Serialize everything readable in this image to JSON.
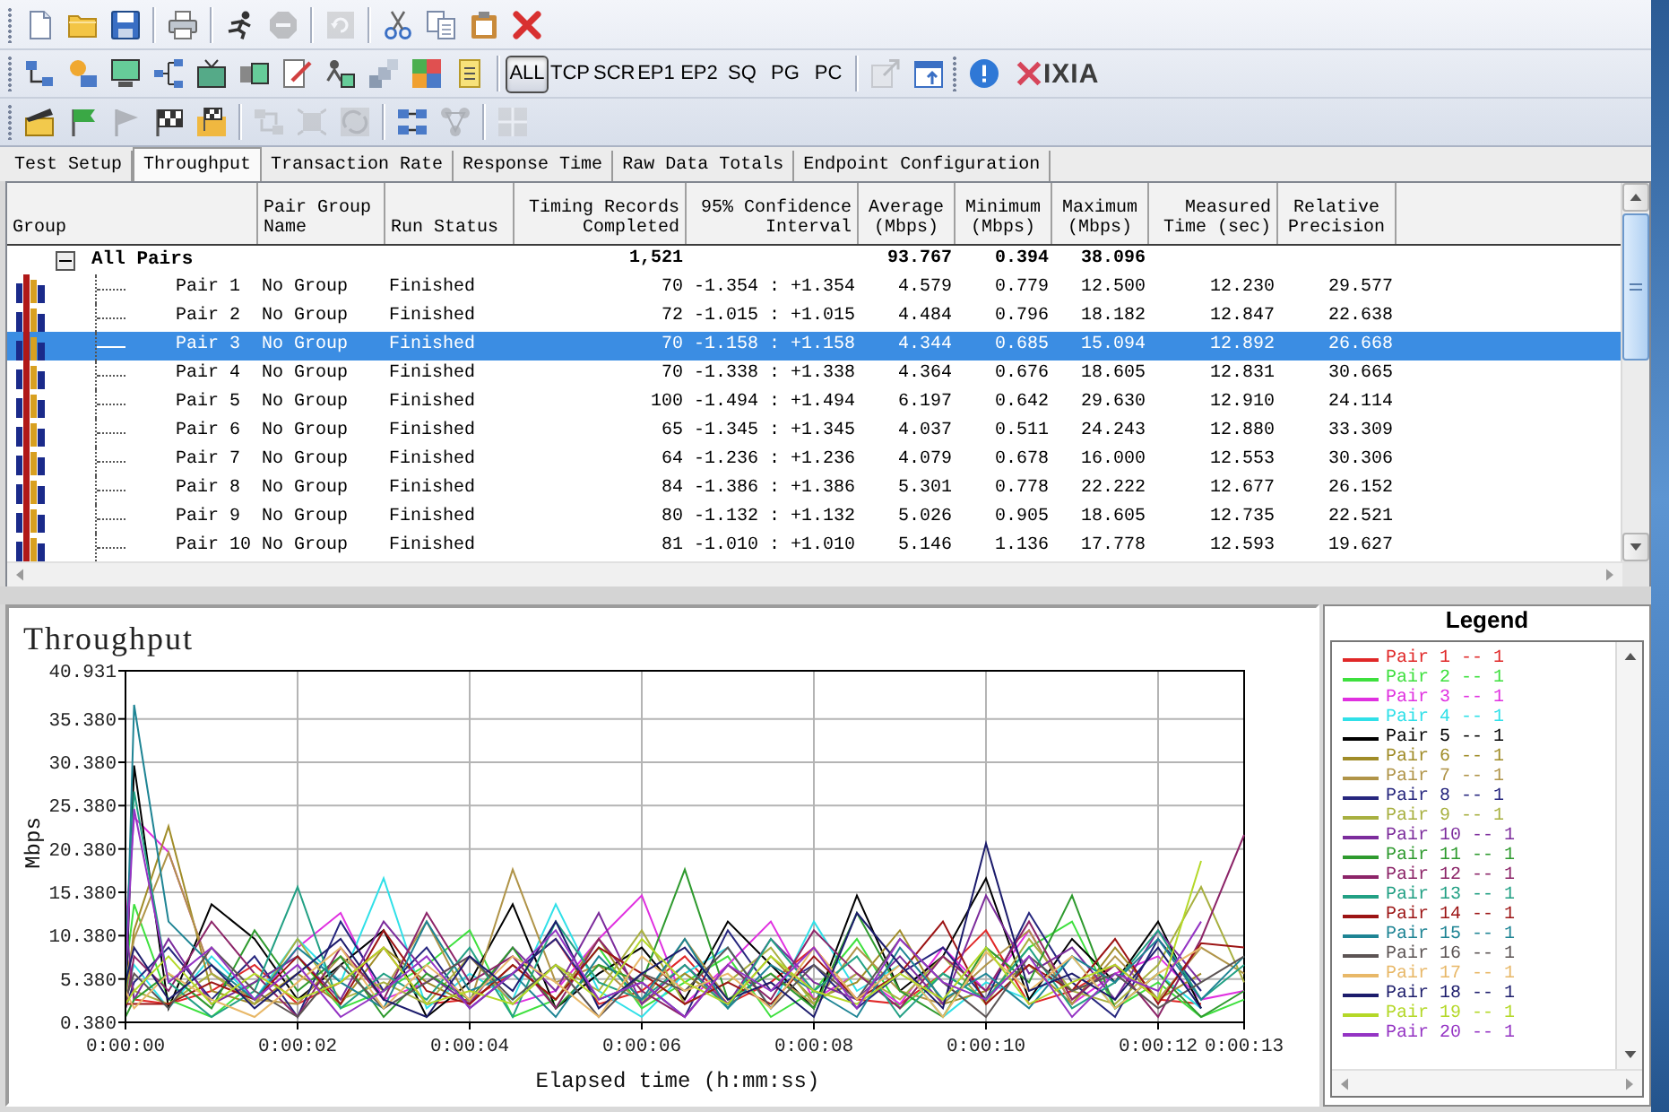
{
  "toolbar_rows": [
    {
      "items": [
        {
          "kind": "grip"
        },
        {
          "kind": "button",
          "disabled": false
        },
        {
          "kind": "button",
          "disabled": false
        },
        {
          "kind": "button",
          "disabled": false
        },
        {
          "kind": "separator"
        },
        {
          "kind": "button",
          "disabled": false
        },
        {
          "kind": "separator"
        },
        {
          "kind": "button",
          "disabled": false
        },
        {
          "kind": "button",
          "disabled": true
        },
        {
          "kind": "separator"
        },
        {
          "kind": "button",
          "disabled": true
        },
        {
          "kind": "separator"
        },
        {
          "kind": "button",
          "disabled": false
        },
        {
          "kind": "button",
          "disabled": false
        },
        {
          "kind": "button",
          "disabled": false
        },
        {
          "kind": "button",
          "disabled": false
        }
      ]
    },
    {
      "items": [
        {
          "kind": "grip"
        },
        {
          "kind": "button",
          "disabled": false
        },
        {
          "kind": "button",
          "disabled": false
        },
        {
          "kind": "button",
          "disabled": false
        },
        {
          "kind": "button",
          "disabled": false
        },
        {
          "kind": "button",
          "disabled": false
        },
        {
          "kind": "button",
          "disabled": false
        },
        {
          "kind": "button",
          "disabled": false
        },
        {
          "kind": "button",
          "disabled": false
        },
        {
          "kind": "button",
          "disabled": false
        },
        {
          "kind": "button",
          "disabled": false
        },
        {
          "kind": "button",
          "disabled": false
        },
        {
          "kind": "separator"
        },
        {
          "kind": "toggle",
          "label": "ALL",
          "selected": true
        },
        {
          "kind": "toggle",
          "label": "TCP",
          "selected": false
        },
        {
          "kind": "toggle",
          "label": "SCR",
          "selected": false
        },
        {
          "kind": "toggle",
          "label": "EP1",
          "selected": false
        },
        {
          "kind": "toggle",
          "label": "EP2",
          "selected": false
        },
        {
          "kind": "toggle",
          "label": "SQ",
          "selected": false
        },
        {
          "kind": "toggle",
          "label": "PG",
          "selected": false
        },
        {
          "kind": "toggle",
          "label": "PC",
          "selected": false
        },
        {
          "kind": "separator"
        },
        {
          "kind": "button",
          "disabled": true
        },
        {
          "kind": "button",
          "disabled": false
        },
        {
          "kind": "grip"
        },
        {
          "kind": "button",
          "disabled": false
        },
        {
          "kind": "logo",
          "text": "IXIA"
        }
      ]
    },
    {
      "items": [
        {
          "kind": "grip"
        },
        {
          "kind": "button",
          "disabled": false
        },
        {
          "kind": "button",
          "disabled": false
        },
        {
          "kind": "button",
          "disabled": true
        },
        {
          "kind": "button",
          "disabled": false
        },
        {
          "kind": "button",
          "disabled": false
        },
        {
          "kind": "separator"
        },
        {
          "kind": "button",
          "disabled": true
        },
        {
          "kind": "button",
          "disabled": true
        },
        {
          "kind": "button",
          "disabled": true
        },
        {
          "kind": "separator"
        },
        {
          "kind": "button",
          "disabled": false
        },
        {
          "kind": "button",
          "disabled": true
        },
        {
          "kind": "separator"
        },
        {
          "kind": "button",
          "disabled": true
        }
      ]
    }
  ],
  "tabs": [
    {
      "label": "Test Setup",
      "selected": false
    },
    {
      "label": "Throughput",
      "selected": true
    },
    {
      "label": "Transaction Rate",
      "selected": false
    },
    {
      "label": "Response Time",
      "selected": false
    },
    {
      "label": "Raw Data Totals",
      "selected": false
    },
    {
      "label": "Endpoint Configuration",
      "selected": false
    }
  ],
  "table": {
    "columns": [
      "Group",
      "Pair Group Name",
      "Run Status",
      "Timing Records Completed",
      "95% Confidence Interval",
      "Average (Mbps)",
      "Minimum (Mbps)",
      "Maximum (Mbps)",
      "Measured Time (sec)",
      "Relative Precision"
    ],
    "summary": {
      "label": "All Pairs",
      "expanded": true,
      "timing_records_completed": "1,521",
      "average": "93.767",
      "minimum": "0.394",
      "maximum": "38.096"
    },
    "rows": [
      {
        "cells": [
          "Pair 1",
          "No Group",
          "Finished",
          "70",
          "-1.354 : +1.354",
          "4.579",
          "0.779",
          "12.500",
          "12.230",
          "29.577"
        ],
        "selected": false
      },
      {
        "cells": [
          "Pair 2",
          "No Group",
          "Finished",
          "72",
          "-1.015 : +1.015",
          "4.484",
          "0.796",
          "18.182",
          "12.847",
          "22.638"
        ],
        "selected": false
      },
      {
        "cells": [
          "Pair 3",
          "No Group",
          "Finished",
          "70",
          "-1.158 : +1.158",
          "4.344",
          "0.685",
          "15.094",
          "12.892",
          "26.668"
        ],
        "selected": true
      },
      {
        "cells": [
          "Pair 4",
          "No Group",
          "Finished",
          "70",
          "-1.338 : +1.338",
          "4.364",
          "0.676",
          "18.605",
          "12.831",
          "30.665"
        ],
        "selected": false
      },
      {
        "cells": [
          "Pair 5",
          "No Group",
          "Finished",
          "100",
          "-1.494 : +1.494",
          "6.197",
          "0.642",
          "29.630",
          "12.910",
          "24.114"
        ],
        "selected": false
      },
      {
        "cells": [
          "Pair 6",
          "No Group",
          "Finished",
          "65",
          "-1.345 : +1.345",
          "4.037",
          "0.511",
          "24.243",
          "12.880",
          "33.309"
        ],
        "selected": false
      },
      {
        "cells": [
          "Pair 7",
          "No Group",
          "Finished",
          "64",
          "-1.236 : +1.236",
          "4.079",
          "0.678",
          "16.000",
          "12.553",
          "30.306"
        ],
        "selected": false
      },
      {
        "cells": [
          "Pair 8",
          "No Group",
          "Finished",
          "84",
          "-1.386 : +1.386",
          "5.301",
          "0.778",
          "22.222",
          "12.677",
          "26.152"
        ],
        "selected": false
      },
      {
        "cells": [
          "Pair 9",
          "No Group",
          "Finished",
          "80",
          "-1.132 : +1.132",
          "5.026",
          "0.905",
          "18.605",
          "12.735",
          "22.521"
        ],
        "selected": false
      },
      {
        "cells": [
          "Pair 10",
          "No Group",
          "Finished",
          "81",
          "-1.010 : +1.010",
          "5.146",
          "1.136",
          "17.778",
          "12.593",
          "19.627"
        ],
        "selected": false
      }
    ]
  },
  "chart_panel": {
    "chart_data": {
      "type": "line",
      "title": "Throughput",
      "xlabel": "Elapsed time (h:mm:ss)",
      "ylabel": "Mbps",
      "grid": true,
      "x": [
        0,
        0.1,
        0.5,
        1,
        1.5,
        2,
        2.5,
        3,
        3.5,
        4,
        4.5,
        5,
        5.5,
        6,
        6.5,
        7,
        7.5,
        8,
        8.5,
        9,
        9.5,
        10,
        10.5,
        11,
        11.5,
        12,
        12.5,
        13
      ],
      "xlim": [
        0,
        13
      ],
      "ylim": [
        0.38,
        40.931
      ],
      "xticks": [
        {
          "value": 0,
          "label": "0:00:00"
        },
        {
          "value": 2,
          "label": "0:00:02"
        },
        {
          "value": 4,
          "label": "0:00:04"
        },
        {
          "value": 6,
          "label": "0:00:06"
        },
        {
          "value": 8,
          "label": "0:00:08"
        },
        {
          "value": 10,
          "label": "0:00:10"
        },
        {
          "value": 12,
          "label": "0:00:12"
        },
        {
          "value": 13,
          "label": "0:00:13"
        }
      ],
      "yticks": [
        {
          "value": 0.38,
          "label": "0.380"
        },
        {
          "value": 5.38,
          "label": "5.380"
        },
        {
          "value": 10.38,
          "label": "10.380"
        },
        {
          "value": 15.38,
          "label": "15.380"
        },
        {
          "value": 20.38,
          "label": "20.380"
        },
        {
          "value": 25.38,
          "label": "25.380"
        },
        {
          "value": 30.38,
          "label": "30.380"
        },
        {
          "value": 35.38,
          "label": "35.380"
        },
        {
          "value": 40.931,
          "label": "40.931"
        }
      ],
      "series": [
        {
          "name": "Pair 1 -- 1",
          "color": "#e02828",
          "values": [
            9,
            3,
            2.5,
            4,
            7,
            2.5,
            5,
            9,
            2.5,
            3,
            6,
            10,
            2.5,
            4,
            8,
            2.5,
            5,
            9,
            3,
            2.5,
            6,
            11,
            2.5,
            4,
            7,
            3,
            2.5,
            null
          ]
        },
        {
          "name": "Pair 2 -- 1",
          "color": "#3ee03e",
          "values": [
            6,
            14,
            3,
            1,
            5,
            8,
            2,
            4,
            7,
            11,
            1,
            3,
            9,
            2,
            5,
            8,
            1,
            4,
            10,
            2,
            6,
            3,
            9,
            12,
            2,
            5,
            1,
            3
          ]
        },
        {
          "name": "Pair 3 -- 1",
          "color": "#e030e0",
          "values": [
            11,
            24,
            20,
            6,
            2.5,
            9,
            13,
            3,
            5,
            8,
            2.5,
            4,
            10,
            15,
            2.5,
            7,
            12,
            3,
            6,
            2.5,
            9,
            4,
            11,
            2.5,
            6,
            8,
            3,
            4
          ]
        },
        {
          "name": "Pair 4 -- 1",
          "color": "#30e0e8",
          "values": [
            4,
            7,
            2,
            8,
            3,
            10,
            5,
            17,
            2,
            6,
            3,
            14,
            4,
            1,
            6,
            9,
            2,
            12,
            4,
            7,
            1,
            5,
            3,
            8,
            2,
            6,
            2,
            null
          ]
        },
        {
          "name": "Pair 5 -- 1",
          "color": "#000000",
          "values": [
            2,
            30,
            2,
            14,
            10,
            3,
            7,
            11,
            1,
            5,
            14,
            2,
            6,
            9,
            3,
            12,
            7,
            2,
            15,
            4,
            8,
            17,
            3,
            10,
            5,
            12,
            2,
            null
          ]
        },
        {
          "name": "Pair 6 -- 1",
          "color": "#a08c28",
          "values": [
            3,
            11,
            23,
            4,
            2.5,
            6,
            2.5,
            9,
            5,
            2.5,
            7,
            3,
            10,
            2.5,
            6,
            2.5,
            8,
            3,
            5,
            11,
            2.5,
            4,
            7,
            2.5,
            9,
            3,
            6,
            null
          ]
        },
        {
          "name": "Pair 7 -- 1",
          "color": "#b09448",
          "values": [
            5,
            10,
            20,
            6,
            3,
            2.5,
            8,
            4,
            12,
            2.5,
            18,
            5,
            7,
            2.5,
            10,
            3,
            6,
            2.5,
            9,
            4,
            2.5,
            7,
            11,
            2.5,
            8,
            3,
            9,
            6
          ]
        },
        {
          "name": "Pair 8 -- 1",
          "color": "#26267e",
          "values": [
            2,
            5,
            9,
            3,
            8,
            1,
            12,
            4,
            9,
            2,
            6,
            10,
            3,
            5,
            1,
            11,
            4,
            7,
            2,
            6,
            9,
            3,
            13,
            5,
            1,
            10,
            4,
            null
          ]
        },
        {
          "name": "Pair 9 -- 1",
          "color": "#a8b040",
          "values": [
            7,
            4,
            2.5,
            6,
            2.5,
            10,
            3,
            5,
            2.5,
            8,
            2.5,
            7,
            4,
            11,
            2.5,
            5,
            9,
            2.5,
            6,
            3,
            8,
            2.5,
            10,
            4,
            2.5,
            7,
            16,
            5
          ]
        },
        {
          "name": "Pair 10 -- 1",
          "color": "#7c2c9c",
          "values": [
            12,
            3,
            10,
            2.5,
            5,
            8,
            3,
            12,
            6,
            2.5,
            9,
            4,
            13,
            2.5,
            7,
            2.5,
            10,
            5,
            3,
            8,
            2.5,
            15,
            6,
            9,
            3,
            11,
            5,
            null
          ]
        },
        {
          "name": "Pair 11 -- 1",
          "color": "#2e9a2e",
          "values": [
            1,
            3,
            6,
            2,
            11,
            4,
            8,
            1,
            6,
            3,
            9,
            2,
            7,
            5,
            18,
            3,
            6,
            2,
            13,
            4,
            1,
            9,
            5,
            15,
            2,
            6,
            1,
            4
          ]
        },
        {
          "name": "Pair 12 -- 1",
          "color": "#8c2468",
          "values": [
            2,
            8,
            4,
            12,
            6,
            1,
            9,
            3,
            13,
            5,
            8,
            2,
            10,
            4,
            1,
            7,
            3,
            11,
            6,
            2,
            8,
            4,
            12,
            3,
            7,
            1,
            10,
            22
          ]
        },
        {
          "name": "Pair 13 -- 1",
          "color": "#22a084",
          "values": [
            8,
            27,
            5,
            1,
            4,
            16,
            2,
            6,
            3,
            9,
            1,
            12,
            5,
            3,
            7,
            2,
            10,
            4,
            8,
            1,
            6,
            3,
            9,
            2,
            5,
            11,
            3,
            7
          ]
        },
        {
          "name": "Pair 14 -- 1",
          "color": "#9c1414",
          "values": [
            2.5,
            2.5,
            2.5,
            5,
            3,
            8,
            2.5,
            11,
            4,
            2.5,
            7,
            3,
            9,
            6,
            2.5,
            5,
            2.5,
            8,
            3,
            6,
            12,
            2.5,
            7,
            4,
            10,
            2.5,
            9.5,
            9
          ]
        },
        {
          "name": "Pair 15 -- 1",
          "color": "#1e8494",
          "values": [
            3,
            37,
            12,
            7,
            3,
            9,
            5,
            2,
            12,
            4,
            6,
            1,
            8,
            3,
            10,
            2,
            7,
            4,
            1,
            9,
            3,
            6,
            2,
            8,
            5,
            10,
            3,
            8
          ]
        },
        {
          "name": "Pair 16 -- 1",
          "color": "#5c5454",
          "values": [
            3,
            6,
            2,
            9,
            4,
            1,
            7,
            2,
            5,
            8,
            3,
            7,
            1,
            6,
            4,
            9,
            2,
            7,
            3,
            10,
            5,
            1,
            8,
            4,
            6,
            2,
            5,
            8
          ]
        },
        {
          "name": "Pair 17 -- 1",
          "color": "#e8b868",
          "values": [
            4,
            2,
            6,
            3,
            1,
            5,
            9,
            2,
            7,
            3,
            8,
            5,
            1,
            8,
            4,
            6,
            2,
            9,
            3,
            7,
            1,
            8.5,
            4,
            8,
            2,
            6,
            9,
            null
          ]
        },
        {
          "name": "Pair 18 -- 1",
          "color": "#1c1c6c",
          "values": [
            5,
            9,
            3,
            7,
            2,
            6,
            10,
            3,
            1,
            8,
            4,
            12,
            2,
            6,
            9,
            3,
            5,
            1,
            13,
            7,
            2,
            21,
            4,
            6,
            3,
            9,
            2,
            null
          ]
        },
        {
          "name": "Pair 19 -- 1",
          "color": "#b4d828",
          "values": [
            2.5,
            4,
            8,
            2.5,
            6,
            3,
            5,
            9,
            2.5,
            4,
            2.5,
            7,
            3,
            10,
            5,
            2.5,
            8,
            4,
            2.5,
            6,
            3,
            9,
            2.5,
            5,
            7,
            3,
            19,
            null
          ]
        },
        {
          "name": "Pair 20 -- 1",
          "color": "#9434c4",
          "values": [
            6,
            25,
            5,
            9,
            3,
            7,
            1,
            4,
            8,
            2,
            6,
            11,
            3,
            5,
            1,
            7,
            4,
            9,
            2,
            10,
            5,
            3,
            8,
            1,
            6,
            4,
            12,
            null
          ]
        }
      ]
    }
  },
  "legend": {
    "title": "Legend"
  }
}
